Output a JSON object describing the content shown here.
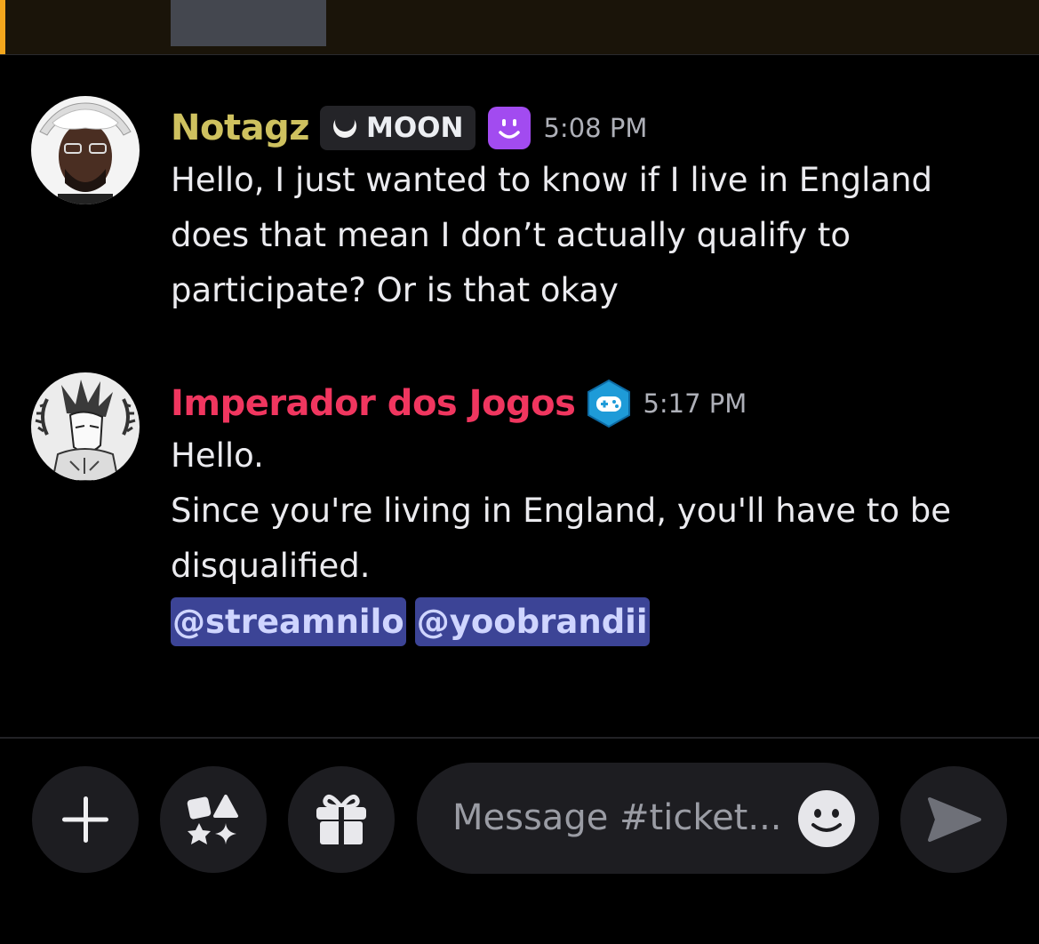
{
  "messages": [
    {
      "username": "Notagz",
      "username_color": "#cec15f",
      "tag": "MOON",
      "timestamp": "5:08 PM",
      "lines": [
        "Hello, I just wanted to know if I live in England",
        "does that mean I don’t actually qualify to",
        "participate? Or is that okay"
      ]
    },
    {
      "username": "Imperador dos Jogos",
      "username_color": "#f0365f",
      "timestamp": "5:17 PM",
      "lines": [
        "Hello.",
        "Since you're living in England, you'll have to be",
        "disqualified."
      ],
      "mentions": [
        "@streamnilo",
        "@yoobrandii"
      ]
    }
  ],
  "composer": {
    "placeholder": "Message #ticket..."
  },
  "icons": {
    "add": "plus-icon",
    "apps": "apps-icon",
    "gift": "gift-icon",
    "emoji": "emoji-icon",
    "send": "send-icon"
  },
  "colors": {
    "background": "#000000",
    "accent": "#f2a61d",
    "mention_bg": "#3c4496"
  }
}
